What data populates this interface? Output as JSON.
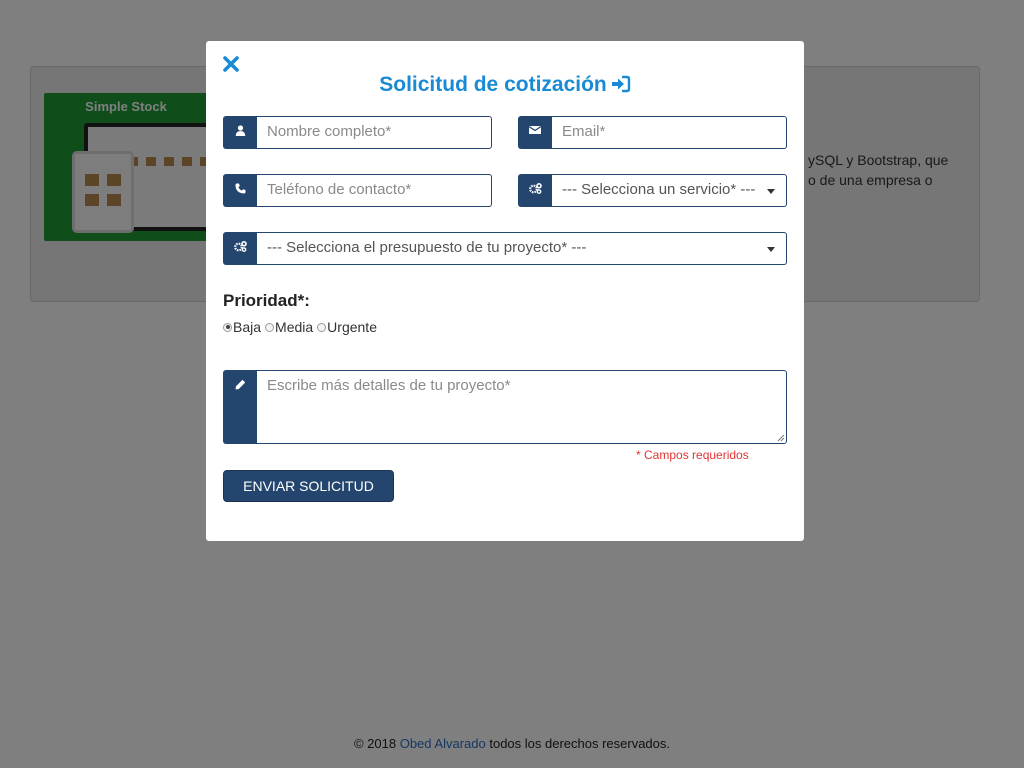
{
  "background": {
    "thumbnail_title": "Simple Stock",
    "description_fragment_1": "ySQL y Bootstrap, que",
    "description_fragment_2": "o de una empresa o"
  },
  "modal": {
    "title": "Solicitud de cotización",
    "title_icon": "sign-in-icon",
    "close_icon": "close-icon",
    "fields": {
      "name": {
        "placeholder": "Nombre completo*",
        "icon": "user-icon"
      },
      "email": {
        "placeholder": "Email*",
        "icon": "envelope-icon"
      },
      "phone": {
        "placeholder": "Teléfono de contacto*",
        "icon": "phone-icon"
      },
      "service": {
        "selected": "--- Selecciona un servicio* ---",
        "icon": "gears-icon"
      },
      "budget": {
        "selected": "--- Selecciona el presupuesto de tu proyecto* ---",
        "icon": "gears-icon"
      },
      "details": {
        "placeholder": "Escribe más detalles de tu proyecto*",
        "icon": "pencil-icon"
      }
    },
    "priority": {
      "label": "Prioridad*:",
      "options": [
        {
          "label": "Baja",
          "checked": true
        },
        {
          "label": "Media",
          "checked": false
        },
        {
          "label": "Urgente",
          "checked": false
        }
      ]
    },
    "required_note": "* Campos requeridos",
    "submit_label": "ENVIAR SOLICITUD"
  },
  "footer": {
    "prefix": "© 2018 ",
    "author": "Obed Alvarado",
    "suffix": " todos los derechos reservados."
  },
  "colors": {
    "accent": "#1a8ad4",
    "navy": "#24456e",
    "required": "#e33333",
    "overlay": "rgba(0,0,0,0.5)"
  }
}
